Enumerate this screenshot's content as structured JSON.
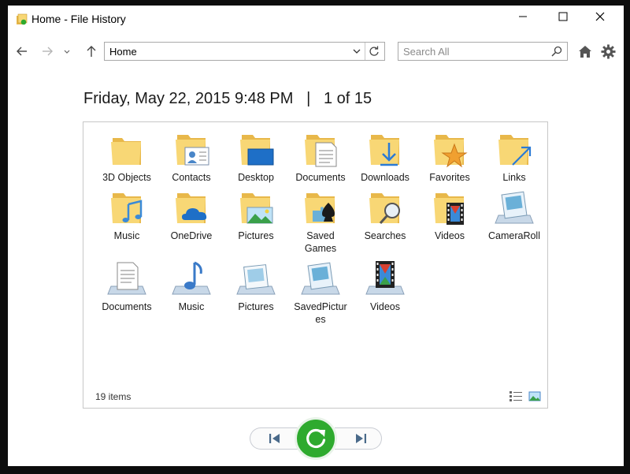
{
  "window": {
    "title": "Home - File History"
  },
  "navigation": {
    "address": "Home",
    "search_placeholder": "Search All"
  },
  "snapshot": {
    "date": "Friday, May 22, 2015 9:48 PM",
    "separator": "|",
    "position": "1 of 15"
  },
  "items": [
    {
      "label": "3D Objects",
      "icon": "folder-icon"
    },
    {
      "label": "Contacts",
      "icon": "contacts-folder-icon"
    },
    {
      "label": "Desktop",
      "icon": "desktop-folder-icon"
    },
    {
      "label": "Documents",
      "icon": "documents-folder-icon"
    },
    {
      "label": "Downloads",
      "icon": "downloads-folder-icon"
    },
    {
      "label": "Favorites",
      "icon": "favorites-folder-icon"
    },
    {
      "label": "Links",
      "icon": "links-folder-icon"
    },
    {
      "label": "Music",
      "icon": "music-folder-icon"
    },
    {
      "label": "OneDrive",
      "icon": "onedrive-folder-icon"
    },
    {
      "label": "Pictures",
      "icon": "pictures-folder-icon"
    },
    {
      "label": "Saved\nGames",
      "icon": "saved-games-folder-icon"
    },
    {
      "label": "Searches",
      "icon": "searches-folder-icon"
    },
    {
      "label": "Videos",
      "icon": "videos-folder-icon"
    },
    {
      "label": "CameraRoll",
      "icon": "camera-roll-library-icon"
    },
    {
      "label": "Documents",
      "icon": "documents-library-icon"
    },
    {
      "label": "Music",
      "icon": "music-library-icon"
    },
    {
      "label": "Pictures",
      "icon": "pictures-library-icon"
    },
    {
      "label": "SavedPictur\nes",
      "icon": "saved-pictures-library-icon"
    },
    {
      "label": "Videos",
      "icon": "videos-library-icon"
    }
  ],
  "status": {
    "item_count": "19 items"
  },
  "colors": {
    "restore_button": "#2eaa2e",
    "folder_yellow": "#f8d775",
    "folder_dark": "#e8b84a"
  }
}
